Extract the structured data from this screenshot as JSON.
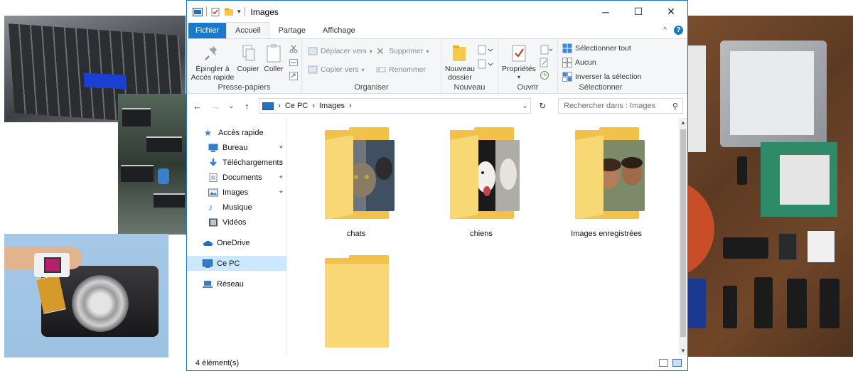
{
  "window": {
    "title": "Images",
    "minimize": "─",
    "maximize": "☐",
    "close": "✕"
  },
  "ribbon_tabs": {
    "file": "Fichier",
    "home": "Accueil",
    "share": "Partage",
    "view": "Affichage",
    "collapse": "^",
    "help": "?"
  },
  "ribbon": {
    "clipboard": {
      "label": "Presse-papiers",
      "pin": "Épingler à\nAccès rapide",
      "copy": "Copier",
      "paste": "Coller"
    },
    "organize": {
      "label": "Organiser",
      "move_to": "Déplacer vers",
      "copy_to": "Copier vers",
      "delete": "Supprimer",
      "rename": "Renommer"
    },
    "new": {
      "label": "Nouveau",
      "new_folder": "Nouveau\ndossier"
    },
    "open": {
      "label": "Ouvrir",
      "properties": "Propriétés"
    },
    "select": {
      "label": "Sélectionner",
      "select_all": "Sélectionner tout",
      "select_none": "Aucun",
      "invert": "Inverser la sélection"
    }
  },
  "address": {
    "back": "←",
    "forward": "→",
    "recent": "⌄",
    "up": "↑",
    "crumbs": [
      "Ce PC",
      "Images"
    ],
    "separator": "›",
    "dropdown": "⌄",
    "refresh": "↻",
    "search_placeholder": "Rechercher dans : Images",
    "search_glyph": "⚲"
  },
  "nav": {
    "quick_access": "Accès rapide",
    "desktop": "Bureau",
    "downloads": "Téléchargements",
    "documents": "Documents",
    "pictures": "Images",
    "music": "Musique",
    "videos": "Vidéos",
    "onedrive": "OneDrive",
    "this_pc": "Ce PC",
    "network": "Réseau",
    "pin_glyph": "📌"
  },
  "files": [
    {
      "name": "chats"
    },
    {
      "name": "chiens"
    },
    {
      "name": "Images enregistrées"
    },
    {
      "name": ""
    }
  ],
  "status": {
    "count": "4 élément(s)"
  },
  "colors": {
    "accent": "#1979ca",
    "folder_back": "#f2c14a",
    "folder_front": "#f8d775",
    "selection": "#cce8ff"
  }
}
